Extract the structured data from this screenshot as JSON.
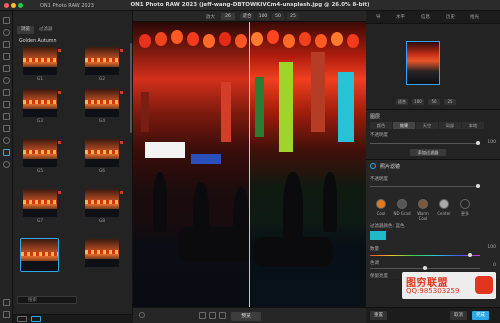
{
  "window": {
    "title": "ON1 Photo RAW 2023 (jeff-wang-DBTOWKIVCm4-unsplash.jpg @ 26.0% 8-bit)",
    "app_name": "ON1 Photo RAW 2023"
  },
  "filmstrip": {
    "tabs": [
      "浏览",
      "过滤器"
    ],
    "folder": "Golden Autumn",
    "labels": [
      "G1",
      "G2",
      "G3",
      "G4",
      "G5",
      "G6",
      "G7",
      "G8"
    ],
    "search_placeholder": "搜索"
  },
  "toolbar": {
    "zoom_label": "放大",
    "zoom_value": "26",
    "fit_label": "适合",
    "z1": "100",
    "z2": "50",
    "z3": "25"
  },
  "canvas": {
    "preview_label": "预览"
  },
  "right": {
    "tabs": [
      "导",
      "水平",
      "信息",
      "历史",
      "拾光"
    ],
    "nav_buttons": [
      "适合",
      "100",
      "50",
      "25"
    ],
    "layers_title": "图层",
    "layer_tabs": [
      "颜色",
      "效果",
      "天空",
      "局部",
      "本地"
    ],
    "opacity_label": "不透明度",
    "add_filter": "添加过滤器",
    "filter_title": "照片滤镜",
    "opacity_label2": "不透明度",
    "presets": [
      "Cool",
      "ND Grad",
      "Warm Cool",
      "Center",
      "更多"
    ],
    "filter_color_label": "过滤器颜色: 蓝色",
    "density_label": "数量",
    "density_value": "100",
    "color_label": "色调",
    "color_value": "0",
    "lum_label": "保留亮度",
    "footer_buttons": [
      "重置",
      "取消",
      "完成"
    ],
    "value_100": "100"
  },
  "watermark": {
    "line1": "图穷联盟",
    "line2": "QQ:985303259"
  },
  "colors": {
    "accent": "#2aa8e8",
    "selection": "#3aa3ff",
    "teal_swatch": "#1fb9c9"
  }
}
